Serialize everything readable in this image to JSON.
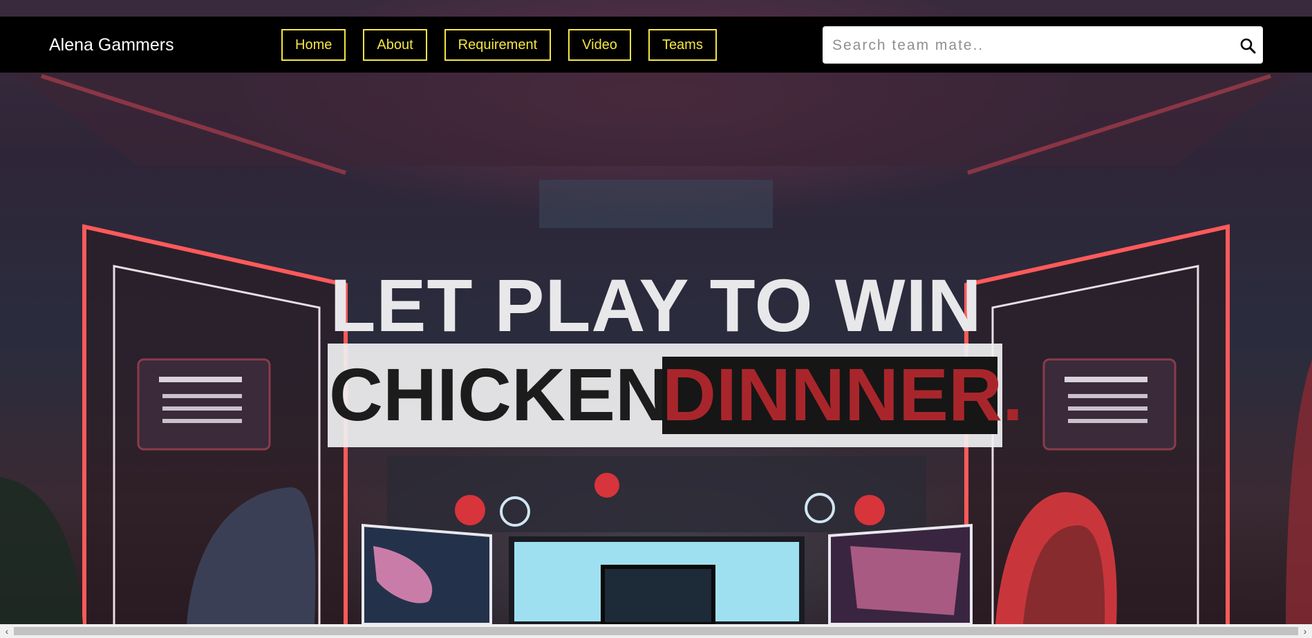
{
  "navbar": {
    "brand": "Alena Gammers",
    "links": [
      "Home",
      "About",
      "Requirement",
      "Video",
      "Teams"
    ],
    "search": {
      "placeholder": "Search team mate..",
      "value": "",
      "icon": "search-icon"
    }
  },
  "hero": {
    "line1": "LET PLAY TO WIN",
    "line2_prefix": "CHICKEN",
    "line2_accent": "DINNNER."
  },
  "colors": {
    "nav_bg": "#000000",
    "nav_link": "#f5e642",
    "hero_text_light": "#e8e8ea",
    "hero_text_dark": "#1c1c1c",
    "accent_red": "#a8262b",
    "highlight_bg": "#161616"
  },
  "scrollbar": {
    "left_arrow": "‹",
    "right_arrow": "›"
  }
}
